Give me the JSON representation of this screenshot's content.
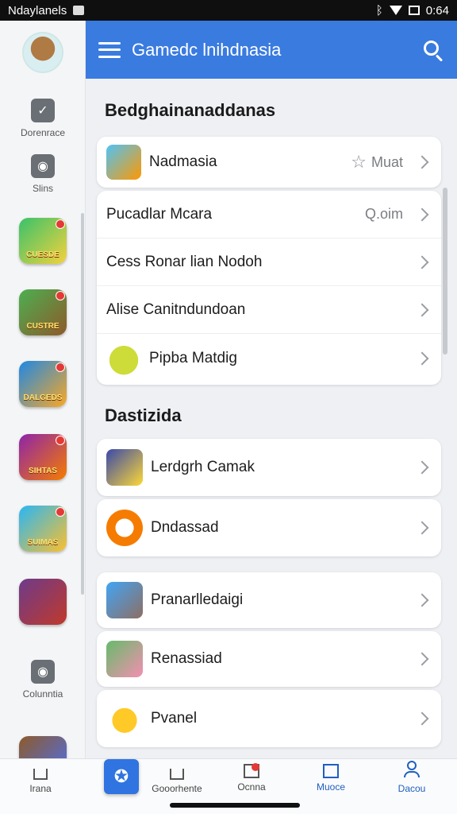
{
  "status_bar": {
    "carrier": "Ndaylanels",
    "time": "0:64"
  },
  "app_bar": {
    "title": "Gamedc lnihdnasia",
    "menu_icon": "hamburger-icon",
    "search_icon": "search-icon",
    "color": "#3a7be0"
  },
  "rail": {
    "avatar_icon": "avatar",
    "buttons": [
      {
        "label": "Dorenrace",
        "icon": "checkbox-icon"
      },
      {
        "label": "Slins",
        "icon": "camera-icon"
      },
      {
        "label": "Colunntia",
        "icon": "camera-icon"
      }
    ],
    "games": [
      {
        "caption": "CUESDE",
        "colors": [
          "#39c26b",
          "#f4d23c"
        ]
      },
      {
        "caption": "CUSTRE",
        "colors": [
          "#4caf50",
          "#8d5a2b"
        ]
      },
      {
        "caption": "DALGEDS",
        "colors": [
          "#1e88e5",
          "#f9a825"
        ]
      },
      {
        "caption": "SIHTAS",
        "colors": [
          "#8e24aa",
          "#f57c00"
        ]
      },
      {
        "caption": "SUIMAS",
        "colors": [
          "#29b6f6",
          "#fbc02d"
        ]
      },
      {
        "caption": "",
        "colors": [
          "#6d3b8a",
          "#c0392b"
        ]
      }
    ]
  },
  "section1": {
    "title": "Bedghainanaddanas",
    "featured": {
      "label": "Nadmasia",
      "meta": "Muat",
      "meta_icon": "star-icon"
    },
    "items": [
      {
        "label": "Pucadlar Mcara",
        "meta": "Q.oim"
      },
      {
        "label": "Cess Ronar lian Nodoh",
        "meta": ""
      },
      {
        "label": "Alise Canitndundoan",
        "meta": ""
      },
      {
        "label": "Pipba Matdig",
        "meta": ""
      }
    ]
  },
  "section2": {
    "title": "Dastizida",
    "items": [
      {
        "label": "Lerdgrh Camak"
      },
      {
        "label": "Dndassad"
      }
    ]
  },
  "section3": {
    "items": [
      {
        "label": "Pranarlledaigi"
      },
      {
        "label": "Renassiad"
      },
      {
        "label": "Pvanel"
      }
    ]
  },
  "bottom_nav": {
    "items": [
      {
        "label": "Irana",
        "icon": "home-icon"
      },
      {
        "label": "Gooorhente",
        "icon": "home-icon"
      },
      {
        "label": "Ocnna",
        "icon": "news-icon"
      },
      {
        "label": "Muoce",
        "icon": "building-icon"
      },
      {
        "label": "Dacou",
        "icon": "profile-icon"
      }
    ],
    "active_color": "#1f5fbf"
  }
}
